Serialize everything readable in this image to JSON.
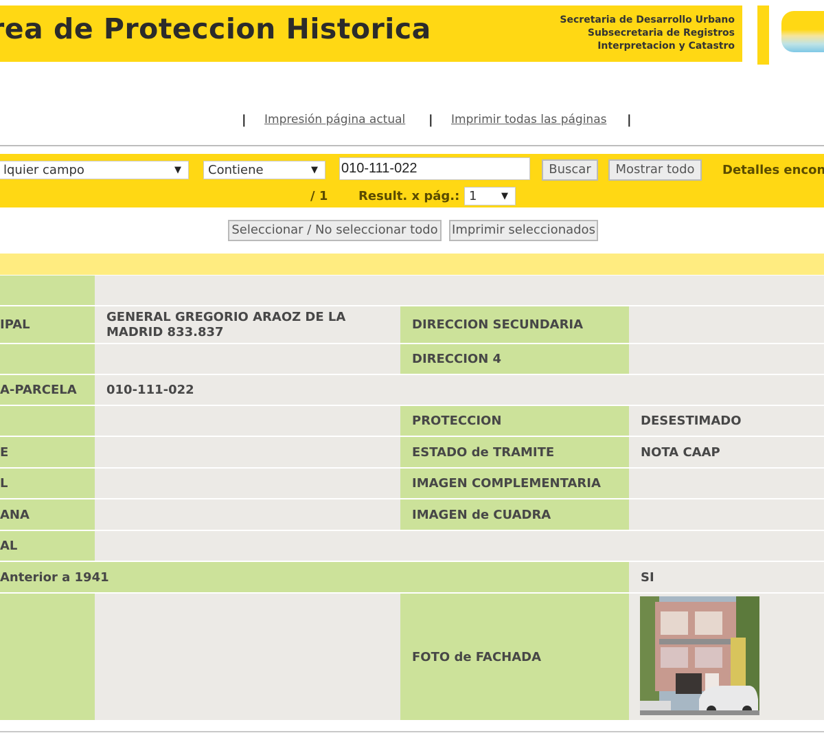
{
  "header": {
    "title": "rea de Proteccion Historica",
    "dept_lines": [
      "Secretaria de Desarrollo Urbano",
      "Subsecretaria de Registros",
      "Interpretacion y Catastro"
    ]
  },
  "print_links": {
    "current_page": "Impresión página actual",
    "all_pages": "Imprimir todas las páginas",
    "separator": "|"
  },
  "search": {
    "field_select": "lquier campo",
    "operator_select": "Contiene",
    "query": "010-111-022",
    "search_button": "Buscar",
    "show_all_button": "Mostrar todo",
    "found_text": "Detalles encon",
    "page_of": "/ 1",
    "results_per_page_label": "Result. x pág.:",
    "results_per_page_value": "1"
  },
  "selection": {
    "toggle_all_button": "Seleccionar / No seleccionar todo",
    "print_selected_button": "Imprimir seleccionados"
  },
  "record": {
    "rows": [
      {
        "label": "IPAL",
        "value": "GENERAL GREGORIO ARAOZ DE LA MADRID 833.837",
        "label2": "DIRECCION SECUNDARIA",
        "value2": ""
      },
      {
        "label": "",
        "value": "",
        "label2": "DIRECCION 4",
        "value2": ""
      },
      {
        "label": "A-PARCELA",
        "value": "010-111-022"
      },
      {
        "label": "",
        "value": "",
        "label2": "PROTECCION",
        "value2": "DESESTIMADO"
      },
      {
        "label": "E",
        "value": "",
        "label2": "ESTADO de TRAMITE",
        "value2": "NOTA CAAP"
      },
      {
        "label": "L",
        "value": "",
        "label2": "IMAGEN COMPLEMENTARIA",
        "value2": ""
      },
      {
        "label": "ANA",
        "value": "",
        "label2": "IMAGEN de CUADRA",
        "value2": ""
      },
      {
        "label": "AL",
        "value": ""
      },
      {
        "label": " Anterior a 1941",
        "value2": "SI"
      },
      {
        "label": "",
        "value": "",
        "label2": "FOTO de FACHADA",
        "photo": "facade-photo"
      }
    ]
  },
  "colors": {
    "yellow": "#ffd814",
    "light_yellow": "#ffec80",
    "green": "#cce29a",
    "gray": "#eceae6"
  }
}
